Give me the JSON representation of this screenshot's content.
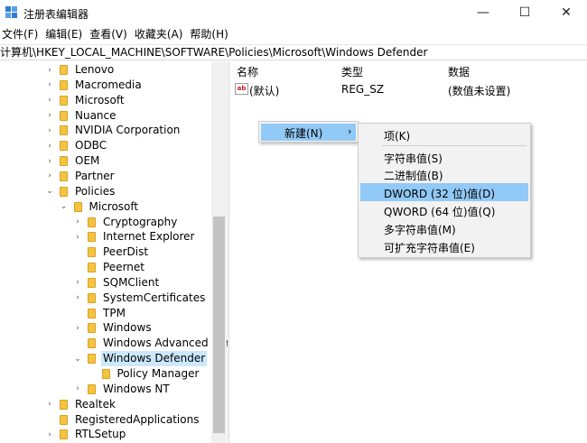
{
  "window": {
    "title": "注册表编辑器",
    "minimize_glyph": "—",
    "maximize_glyph": "☐",
    "close_glyph": "✕"
  },
  "menubar": [
    {
      "label": "文件(F)"
    },
    {
      "label": "编辑(E)"
    },
    {
      "label": "查看(V)"
    },
    {
      "label": "收藏夹(A)"
    },
    {
      "label": "帮助(H)"
    }
  ],
  "address": "计算机\\HKEY_LOCAL_MACHINE\\SOFTWARE\\Policies\\Microsoft\\Windows Defender",
  "tree": [
    {
      "label": "Lenovo",
      "expander": "›"
    },
    {
      "label": "Macromedia",
      "expander": "›"
    },
    {
      "label": "Microsoft",
      "expander": "›"
    },
    {
      "label": "Nuance",
      "expander": "›"
    },
    {
      "label": "NVIDIA Corporation",
      "expander": "›"
    },
    {
      "label": "ODBC",
      "expander": "›"
    },
    {
      "label": "OEM",
      "expander": "›"
    },
    {
      "label": "Partner",
      "expander": "›"
    },
    {
      "label": "Policies",
      "expander": "⌄"
    },
    {
      "label": "Microsoft",
      "expander": "⌄"
    },
    {
      "label": "Cryptography",
      "expander": "›"
    },
    {
      "label": "Internet Explorer",
      "expander": "›"
    },
    {
      "label": "PeerDist",
      "expander": ""
    },
    {
      "label": "Peernet",
      "expander": ""
    },
    {
      "label": "SQMClient",
      "expander": "›"
    },
    {
      "label": "SystemCertificates",
      "expander": "›"
    },
    {
      "label": "TPM",
      "expander": ""
    },
    {
      "label": "Windows",
      "expander": "›"
    },
    {
      "label": "Windows Advanced Threat Protection",
      "expander": ""
    },
    {
      "label": "Windows Defender",
      "expander": "⌄",
      "selected": true
    },
    {
      "label": "Policy Manager",
      "expander": ""
    },
    {
      "label": "Windows NT",
      "expander": "›"
    },
    {
      "label": "Realtek",
      "expander": "›"
    },
    {
      "label": "RegisteredApplications",
      "expander": ""
    },
    {
      "label": "RTLSetup",
      "expander": "›"
    }
  ],
  "list": {
    "columns": {
      "name": "名称",
      "type": "类型",
      "data": "数据"
    },
    "rows": [
      {
        "icon": "ab",
        "name": "(默认)",
        "type": "REG_SZ",
        "data": "(数值未设置)"
      }
    ]
  },
  "context_menu": {
    "new_label": "新建(N)",
    "new_arrow": "›"
  },
  "submenu": [
    {
      "label": "项(K)"
    },
    {
      "label": "字符串值(S)"
    },
    {
      "label": "二进制值(B)"
    },
    {
      "label": "DWORD (32 位)值(D)",
      "highlighted": true
    },
    {
      "label": "QWORD (64 位)值(Q)"
    },
    {
      "label": "多字符串值(M)"
    },
    {
      "label": "可扩充字符串值(E)"
    }
  ],
  "colors": {
    "menu_highlight": "#91c9f7",
    "selection": "#cce8ff",
    "folder": "#f5c342"
  }
}
